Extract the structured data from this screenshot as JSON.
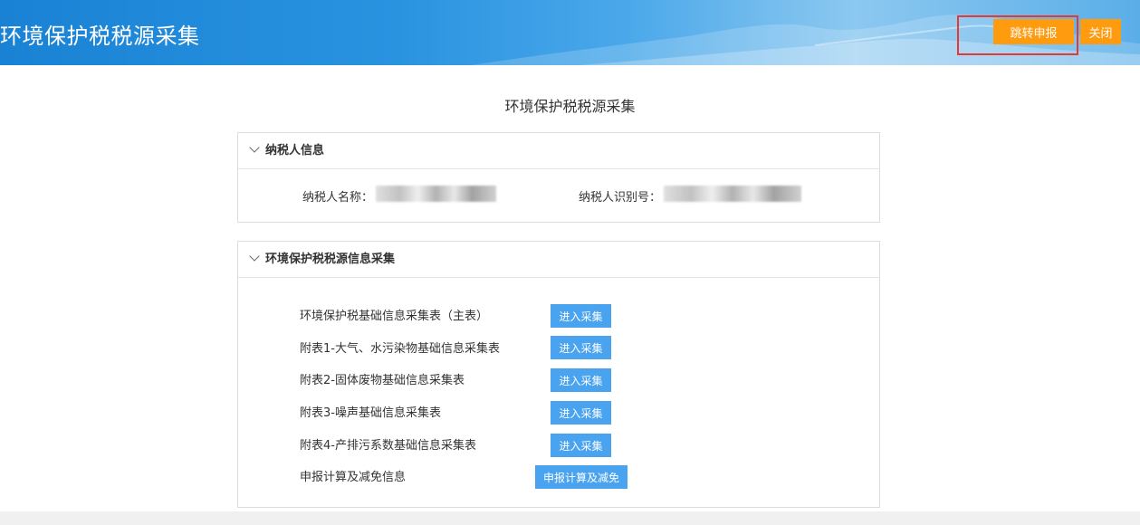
{
  "header": {
    "title": "环境保护税税源采集",
    "jump_button": "跳转申报",
    "close_button": "关闭"
  },
  "page_title": "环境保护税税源采集",
  "taxpayer_panel": {
    "heading": "纳税人信息",
    "name_label": "纳税人名称：",
    "id_label": "纳税人识别号："
  },
  "collection_panel": {
    "heading": "环境保护税税源信息采集",
    "items": [
      {
        "label": "环境保护税基础信息采集表（主表）",
        "button": "进入采集"
      },
      {
        "label": "附表1-大气、水污染物基础信息采集表",
        "button": "进入采集"
      },
      {
        "label": "附表2-固体废物基础信息采集表",
        "button": "进入采集"
      },
      {
        "label": "附表3-噪声基础信息采集表",
        "button": "进入采集"
      },
      {
        "label": "附表4-产排污系数基础信息采集表",
        "button": "进入采集"
      }
    ],
    "calc_label": "申报计算及减免信息",
    "calc_button": "申报计算及减免"
  },
  "colors": {
    "header_blue": "#1a82d4",
    "action_orange": "#ff9b0f",
    "button_blue": "#4aa3ef",
    "highlight_red": "#e53935"
  }
}
